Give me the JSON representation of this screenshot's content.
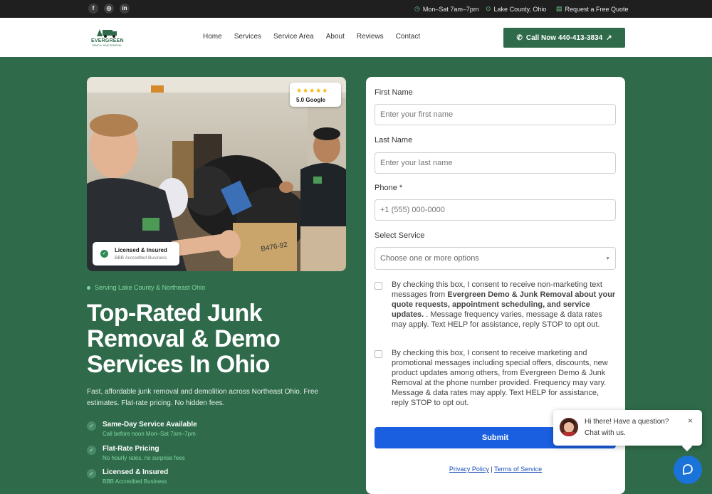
{
  "topbar": {
    "social": [
      "facebook-icon",
      "instagram-icon",
      "linkedin-icon"
    ],
    "hours": "Mon–Sat 7am–7pm",
    "location": "Lake County, Ohio",
    "quote": "Request a Free Quote"
  },
  "nav": {
    "logo_word": "EVERGREEN",
    "logo_sub": "DEMO & JUNK REMOVAL",
    "links": [
      "Home",
      "Services",
      "Service Area",
      "About",
      "Reviews",
      "Contact"
    ],
    "call": "Call Now 440-413-3834"
  },
  "hero": {
    "rating_stars": "★★★★★",
    "rating_text": "5.0 Google",
    "licensed_title": "Licensed & Insured",
    "licensed_sub": "BBB Accredited Business",
    "tagline": "Serving Lake County & Northeast Ohio",
    "headline": "Top-Rated Junk Removal & Demo Services In Ohio",
    "description": "Fast, affordable junk removal and demolition across Northeast Ohio. Free estimates. Flat-rate pricing. No hidden fees.",
    "features": [
      {
        "title": "Same-Day Service Available",
        "sub": "Call before noon Mon–Sat 7am–7pm"
      },
      {
        "title": "Flat-Rate Pricing",
        "sub": "No hourly rates, no surprise fees"
      },
      {
        "title": "Licensed & Insured",
        "sub": "BBB Accredited Business"
      }
    ]
  },
  "form": {
    "first_name_label": "First Name",
    "first_name_placeholder": "Enter your first name",
    "last_name_label": "Last Name",
    "last_name_placeholder": "Enter your last name",
    "phone_label": "Phone *",
    "phone_placeholder": "+1 (555) 000-0000",
    "service_label": "Select Service",
    "service_placeholder": "Choose one or more options",
    "consent1_a": "By checking this box, I consent to receive non-marketing text messages from ",
    "consent1_b": "Evergreen Demo & Junk Removal about your quote requests, appointment scheduling, and service updates.",
    "consent1_c": " . Message frequency varies, message & data rates may apply. Text HELP for assistance, reply STOP to opt out.",
    "consent2": "By checking this box, I consent to receive marketing and promotional messages including special offers, discounts, new product updates among others, from Evergreen Demo & Junk Removal at the phone number provided. Frequency may vary. Message & data rates may apply. Text HELP for assistance, reply STOP to opt out.",
    "submit": "Submit",
    "privacy": "Privacy Policy",
    "separator": "|",
    "terms": "Terms of Service"
  },
  "chat": {
    "message": "Hi there! Have a question? Chat with us.",
    "close": "×"
  },
  "colors": {
    "brand_green": "#2f6b4b",
    "accent_green": "#7fd7a1",
    "submit_blue": "#1a5fe0",
    "chat_blue": "#1a73d9"
  }
}
